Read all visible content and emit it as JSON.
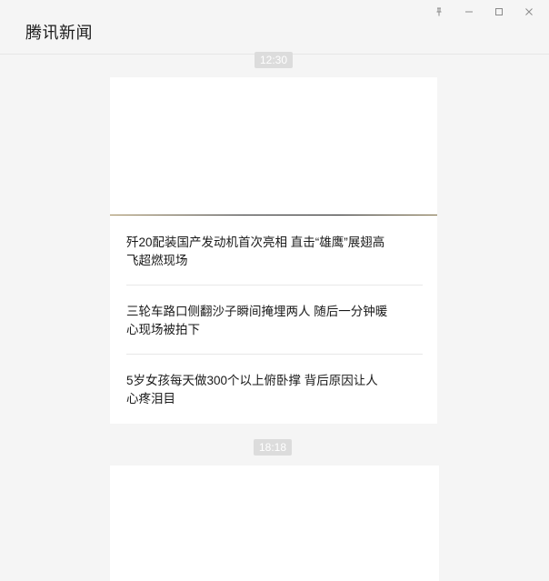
{
  "app": {
    "title": "腾讯新闻"
  },
  "window_controls": {
    "icons": [
      "pin-icon",
      "minimize-icon",
      "maximize-icon",
      "close-icon"
    ]
  },
  "feed": {
    "groups": [
      {
        "time": "12:30",
        "news": [
          {
            "title": "歼20配装国产发动机首次亮相 直击“雄鹰”展翅高飞超燃现场"
          },
          {
            "title": "三轮车路口侧翻沙子瞬间掩埋两人 随后一分钟暖心现场被拍下"
          },
          {
            "title": "5岁女孩每天做300个以上俯卧撑 背后原因让人心疼泪目"
          }
        ]
      },
      {
        "time": "18:18",
        "news": []
      }
    ]
  },
  "colors": {
    "background": "#f5f5f5",
    "card": "#ffffff",
    "time_pill": "#dcdcdc",
    "text": "#1a1a1a"
  }
}
